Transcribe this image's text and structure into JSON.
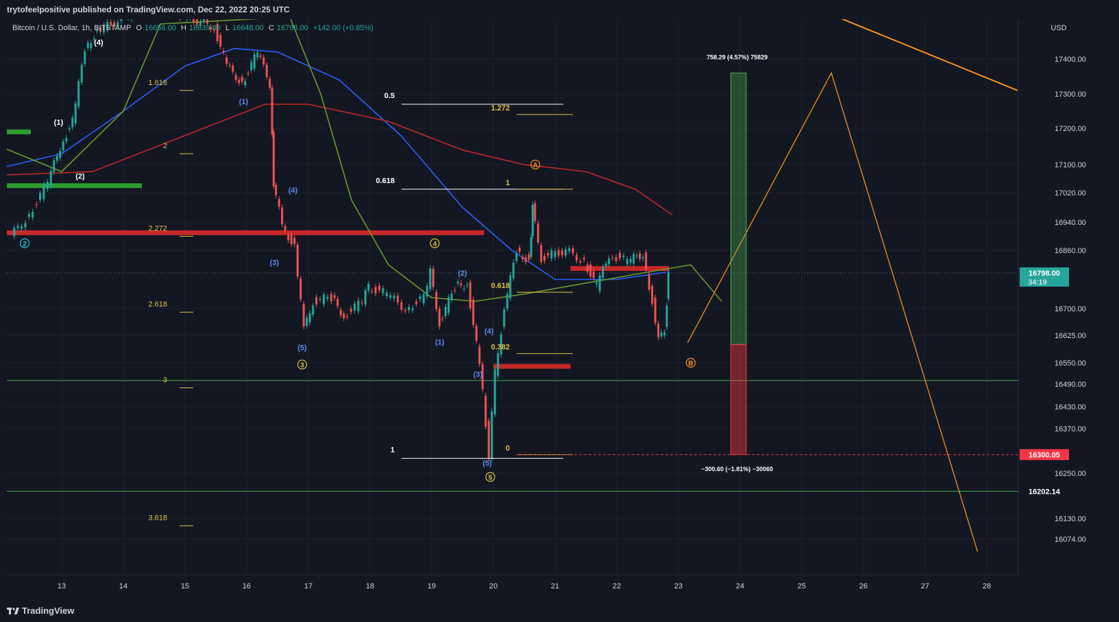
{
  "header": {
    "publish_text": "trytofeelpositive published on TradingView.com, Dec 22, 2022 20:25 UTC"
  },
  "legend": {
    "symbol": "Bitcoin / U.S. Dollar, 1h, BITSTAMP",
    "open_label": "O",
    "open": "16656.00",
    "high_label": "H",
    "high": "16839.00",
    "low_label": "L",
    "low": "16648.00",
    "close_label": "C",
    "close": "16798.00",
    "change": "+142.00 (+0.85%)"
  },
  "footer": {
    "brand": "TradingView"
  },
  "colors": {
    "background": "#131722",
    "up": "#26a69a",
    "down": "#ef5350",
    "grid": "#1e222d",
    "orange": "#f7931a",
    "ma_blue": "#2962ff",
    "ma_red": "#c62828",
    "ma_green": "#6a9c2a"
  },
  "chart_data": {
    "type": "candlestick",
    "symbol": "BTCUSD",
    "exchange": "BITSTAMP",
    "interval": "1h",
    "y_axis_unit": "USD",
    "ylim": [
      16040,
      17540
    ],
    "x_tick_labels": [
      "13",
      "14",
      "15",
      "16",
      "17",
      "18",
      "19",
      "20",
      "21",
      "22",
      "23",
      "24",
      "25",
      "26",
      "27",
      "28"
    ],
    "y_tick_labels": [
      "17400.00",
      "17300.00",
      "17200.00",
      "17100.00",
      "17020.00",
      "16940.00",
      "16860.00",
      "16700.00",
      "16625.00",
      "16550.00",
      "16490.00",
      "16430.00",
      "16370.00",
      "16250.00",
      "16130.00",
      "16074.00"
    ],
    "y_ticks": [
      17400,
      17300,
      17200,
      17100,
      17020,
      16940,
      16860,
      16700,
      16625,
      16550,
      16490,
      16430,
      16370,
      16250,
      16130,
      16074
    ],
    "price_badges": [
      {
        "label": "16798.00",
        "sub": "34:19",
        "value": 16798,
        "color": "#26a69a"
      },
      {
        "label": "16300.05",
        "value": 16300.05,
        "color": "#f23645"
      },
      {
        "label": "16202.14",
        "value": 16202.14,
        "color": "#131722"
      }
    ],
    "close_path": [
      {
        "day": 12.2,
        "price": 16900
      },
      {
        "day": 12.5,
        "price": 16960
      },
      {
        "day": 12.8,
        "price": 17050
      },
      {
        "day": 13.0,
        "price": 17150
      },
      {
        "day": 13.2,
        "price": 17220
      },
      {
        "day": 13.4,
        "price": 17430
      },
      {
        "day": 13.6,
        "price": 17480
      },
      {
        "day": 14.5,
        "price": 17560
      },
      {
        "day": 15.5,
        "price": 17490
      },
      {
        "day": 15.7,
        "price": 17380
      },
      {
        "day": 15.95,
        "price": 17330
      },
      {
        "day": 16.2,
        "price": 17420
      },
      {
        "day": 16.4,
        "price": 17330
      },
      {
        "day": 16.45,
        "price": 17050
      },
      {
        "day": 16.6,
        "price": 16930
      },
      {
        "day": 16.8,
        "price": 16870
      },
      {
        "day": 16.95,
        "price": 16640
      },
      {
        "day": 17.1,
        "price": 16720
      },
      {
        "day": 17.4,
        "price": 16730
      },
      {
        "day": 17.6,
        "price": 16680
      },
      {
        "day": 17.9,
        "price": 16720
      },
      {
        "day": 18.0,
        "price": 16760
      },
      {
        "day": 18.3,
        "price": 16740
      },
      {
        "day": 18.6,
        "price": 16700
      },
      {
        "day": 18.9,
        "price": 16730
      },
      {
        "day": 19.0,
        "price": 16800
      },
      {
        "day": 19.15,
        "price": 16660
      },
      {
        "day": 19.4,
        "price": 16760
      },
      {
        "day": 19.6,
        "price": 16770
      },
      {
        "day": 19.75,
        "price": 16600
      },
      {
        "day": 19.85,
        "price": 16470
      },
      {
        "day": 19.95,
        "price": 16300
      },
      {
        "day": 20.05,
        "price": 16520
      },
      {
        "day": 20.2,
        "price": 16700
      },
      {
        "day": 20.4,
        "price": 16860
      },
      {
        "day": 20.6,
        "price": 16830
      },
      {
        "day": 20.65,
        "price": 16980
      },
      {
        "day": 20.8,
        "price": 16840
      },
      {
        "day": 21.2,
        "price": 16860
      },
      {
        "day": 21.5,
        "price": 16830
      },
      {
        "day": 21.7,
        "price": 16760
      },
      {
        "day": 21.9,
        "price": 16850
      },
      {
        "day": 22.2,
        "price": 16830
      },
      {
        "day": 22.45,
        "price": 16850
      },
      {
        "day": 22.6,
        "price": 16720
      },
      {
        "day": 22.7,
        "price": 16610
      },
      {
        "day": 22.8,
        "price": 16640
      },
      {
        "day": 22.85,
        "price": 16798
      }
    ],
    "moving_averages": [
      {
        "color": "#2962ff",
        "points": [
          {
            "day": 12.0,
            "price": 17090
          },
          {
            "day": 13.0,
            "price": 17130
          },
          {
            "day": 14.0,
            "price": 17250
          },
          {
            "day": 15.0,
            "price": 17380
          },
          {
            "day": 15.8,
            "price": 17430
          },
          {
            "day": 16.5,
            "price": 17420
          },
          {
            "day": 17.5,
            "price": 17340
          },
          {
            "day": 18.5,
            "price": 17180
          },
          {
            "day": 19.5,
            "price": 16980
          },
          {
            "day": 20.3,
            "price": 16860
          },
          {
            "day": 21.0,
            "price": 16780
          },
          {
            "day": 22.0,
            "price": 16780
          },
          {
            "day": 22.8,
            "price": 16800
          }
        ]
      },
      {
        "color": "#c62828",
        "points": [
          {
            "day": 12.0,
            "price": 17070
          },
          {
            "day": 13.5,
            "price": 17080
          },
          {
            "day": 15.0,
            "price": 17180
          },
          {
            "day": 16.3,
            "price": 17270
          },
          {
            "day": 17.0,
            "price": 17270
          },
          {
            "day": 18.3,
            "price": 17220
          },
          {
            "day": 19.5,
            "price": 17140
          },
          {
            "day": 20.5,
            "price": 17100
          },
          {
            "day": 21.5,
            "price": 17080
          },
          {
            "day": 22.3,
            "price": 17030
          },
          {
            "day": 22.9,
            "price": 16960
          }
        ]
      },
      {
        "color": "#6a9c2a",
        "points": [
          {
            "day": 12.0,
            "price": 17150
          },
          {
            "day": 13.0,
            "price": 17080
          },
          {
            "day": 14.0,
            "price": 17250
          },
          {
            "day": 14.6,
            "price": 17500
          },
          {
            "day": 16.7,
            "price": 17520
          },
          {
            "day": 17.2,
            "price": 17300
          },
          {
            "day": 17.7,
            "price": 17000
          },
          {
            "day": 18.3,
            "price": 16820
          },
          {
            "day": 19.0,
            "price": 16730
          },
          {
            "day": 19.7,
            "price": 16720
          },
          {
            "day": 20.5,
            "price": 16740
          },
          {
            "day": 21.5,
            "price": 16770
          },
          {
            "day": 22.5,
            "price": 16800
          },
          {
            "day": 23.2,
            "price": 16820
          },
          {
            "day": 23.7,
            "price": 16720
          }
        ]
      }
    ],
    "horizontal_levels": [
      {
        "price": 16500,
        "color": "#4caf50"
      },
      {
        "price": 16202.14,
        "color": "#4caf50"
      },
      {
        "price": 16798,
        "color": "#787b86",
        "dotted": true
      }
    ],
    "zones": [
      {
        "from_day": 12.0,
        "to_day": 14.3,
        "price": 17040,
        "color": "#2e9c2e"
      },
      {
        "from_day": 12.0,
        "to_day": 12.5,
        "price": 17190,
        "color": "#2e9c2e"
      },
      {
        "from_day": 12.0,
        "to_day": 19.85,
        "price": 16910,
        "color": "#c62828"
      },
      {
        "from_day": 20.0,
        "to_day": 21.25,
        "price": 16540,
        "color": "#c62828"
      },
      {
        "from_day": 21.25,
        "to_day": 22.85,
        "price": 16810,
        "color": "#c62828"
      }
    ],
    "fib_levels_left": [
      {
        "label": "1.618",
        "price": 17310
      },
      {
        "label": "2",
        "price": 17130
      },
      {
        "label": "2.272",
        "price": 16900
      },
      {
        "label": "2.618",
        "price": 16690
      },
      {
        "label": "3",
        "price": 16480
      },
      {
        "label": "3.618",
        "price": 16110
      }
    ],
    "fib_retracement": [
      {
        "label": "0.5",
        "price": 17270,
        "color": "#ffffff"
      },
      {
        "label": "0.618",
        "price": 17030,
        "color": "#ffffff"
      },
      {
        "label": "1",
        "price": 16290,
        "color": "#ffffff"
      }
    ],
    "fib_extension": [
      {
        "label": "1.272",
        "price": 17240
      },
      {
        "label": "1",
        "price": 17030
      },
      {
        "label": "0.618",
        "price": 16745
      },
      {
        "label": "0.382",
        "price": 16575
      },
      {
        "label": "0",
        "price": 16300
      }
    ],
    "wave_labels": [
      {
        "text": "(1)",
        "day": 12.95,
        "price": 17210,
        "color": "#ffffff"
      },
      {
        "text": "(2)",
        "day": 13.3,
        "price": 17060,
        "color": "#ffffff"
      },
      {
        "text": "(4)",
        "day": 13.6,
        "price": 17440,
        "color": "#ffffff"
      },
      {
        "text": "(1)",
        "day": 15.95,
        "price": 17270,
        "color": "#5b8def"
      },
      {
        "text": "(4)",
        "day": 16.75,
        "price": 17020,
        "color": "#5b8def"
      },
      {
        "text": "(3)",
        "day": 16.45,
        "price": 16820,
        "color": "#5b8def"
      },
      {
        "text": "(5)",
        "day": 16.9,
        "price": 16585,
        "color": "#5b8def"
      },
      {
        "text": "(1)",
        "day": 19.13,
        "price": 16600,
        "color": "#5b8def"
      },
      {
        "text": "(2)",
        "day": 19.5,
        "price": 16790,
        "color": "#5b8def"
      },
      {
        "text": "(4)",
        "day": 19.93,
        "price": 16630,
        "color": "#5b8def"
      },
      {
        "text": "(3)",
        "day": 19.75,
        "price": 16510,
        "color": "#5b8def"
      },
      {
        "text": "(5)",
        "day": 19.9,
        "price": 16270,
        "color": "#5b8def"
      }
    ],
    "circle_labels": [
      {
        "text": "2",
        "day": 12.4,
        "price": 16880,
        "color": "#26c6da"
      },
      {
        "text": "3",
        "day": 16.9,
        "price": 16545,
        "color": "#e0c341"
      },
      {
        "text": "4",
        "day": 19.05,
        "price": 16880,
        "color": "#e0c341"
      },
      {
        "text": "5",
        "day": 19.95,
        "price": 16240,
        "color": "#e0c341"
      },
      {
        "text": "A",
        "day": 20.68,
        "price": 17100,
        "color": "#f7931a"
      },
      {
        "text": "B",
        "day": 23.2,
        "price": 16550,
        "color": "#f7931a"
      }
    ],
    "projection_path": [
      {
        "day": 23.15,
        "price": 16605
      },
      {
        "day": 25.48,
        "price": 17360
      },
      {
        "day": 27.85,
        "price": 16040
      }
    ],
    "trendline": [
      {
        "day": 25.3,
        "price": 17540
      },
      {
        "day": 28.5,
        "price": 17310
      }
    ],
    "position": {
      "from_day": 23.85,
      "to_day": 24.1,
      "entry": 16600,
      "target": 17360,
      "stop": 16300,
      "target_label": "758.29 (4.57%) 75829",
      "stop_label": "−300.60 (−1.81%) −30060"
    }
  }
}
